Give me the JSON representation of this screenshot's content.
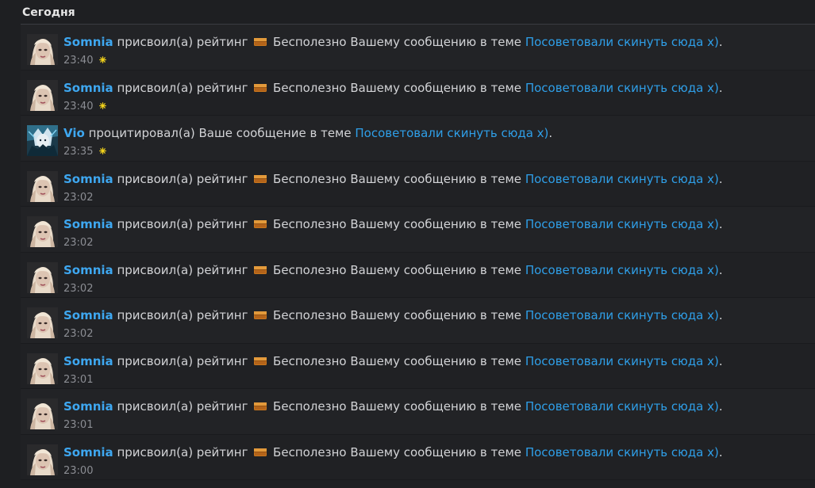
{
  "header": {
    "title": "Сегодня"
  },
  "alerts": [
    {
      "avatar": "somnia-avatar",
      "user": "Somnia",
      "action": "присвоил(а) рейтинг",
      "rating": "Бесполезно",
      "tail": "Вашему сообщению в теме",
      "thread": "Посоветовали скинуть сюда x)",
      "end": ".",
      "time": "23:40",
      "unread": true
    },
    {
      "avatar": "somnia-avatar",
      "user": "Somnia",
      "action": "присвоил(а) рейтинг",
      "rating": "Бесполезно",
      "tail": "Вашему сообщению в теме",
      "thread": "Посоветовали скинуть сюда x)",
      "end": ".",
      "time": "23:40",
      "unread": true
    },
    {
      "avatar": "vio-avatar",
      "user": "Vio",
      "action": "процитировал(а) Ваше сообщение в теме",
      "rating": "",
      "tail": "",
      "thread": "Посоветовали скинуть сюда x)",
      "end": ".",
      "time": "23:35",
      "unread": true
    },
    {
      "avatar": "somnia-avatar",
      "user": "Somnia",
      "action": "присвоил(а) рейтинг",
      "rating": "Бесполезно",
      "tail": "Вашему сообщению в теме",
      "thread": "Посоветовали скинуть сюда x)",
      "end": ".",
      "time": "23:02",
      "unread": false
    },
    {
      "avatar": "somnia-avatar",
      "user": "Somnia",
      "action": "присвоил(а) рейтинг",
      "rating": "Бесполезно",
      "tail": "Вашему сообщению в теме",
      "thread": "Посоветовали скинуть сюда x)",
      "end": ".",
      "time": "23:02",
      "unread": false
    },
    {
      "avatar": "somnia-avatar",
      "user": "Somnia",
      "action": "присвоил(а) рейтинг",
      "rating": "Бесполезно",
      "tail": "Вашему сообщению в теме",
      "thread": "Посоветовали скинуть сюда x)",
      "end": ".",
      "time": "23:02",
      "unread": false
    },
    {
      "avatar": "somnia-avatar",
      "user": "Somnia",
      "action": "присвоил(а) рейтинг",
      "rating": "Бесполезно",
      "tail": "Вашему сообщению в теме",
      "thread": "Посоветовали скинуть сюда x)",
      "end": ".",
      "time": "23:02",
      "unread": false
    },
    {
      "avatar": "somnia-avatar",
      "user": "Somnia",
      "action": "присвоил(а) рейтинг",
      "rating": "Бесполезно",
      "tail": "Вашему сообщению в теме",
      "thread": "Посоветовали скинуть сюда x)",
      "end": ".",
      "time": "23:01",
      "unread": false
    },
    {
      "avatar": "somnia-avatar",
      "user": "Somnia",
      "action": "присвоил(а) рейтинг",
      "rating": "Бесполезно",
      "tail": "Вашему сообщению в теме",
      "thread": "Посоветовали скинуть сюда x)",
      "end": ".",
      "time": "23:01",
      "unread": false
    },
    {
      "avatar": "somnia-avatar",
      "user": "Somnia",
      "action": "присвоил(а) рейтинг",
      "rating": "Бесполезно",
      "tail": "Вашему сообщению в теме",
      "thread": "Посоветовали скинуть сюда x)",
      "end": ".",
      "time": "23:00",
      "unread": false
    }
  ],
  "colors": {
    "background": "#1e1f22",
    "username": "#3ea7f0",
    "link": "#2f9fe8",
    "text": "#d2d3d6",
    "time": "#8b8d93",
    "unread_star": "#f2d21b"
  },
  "icons": {
    "rating": "rating-box-icon",
    "unread": "unread-star-icon"
  }
}
